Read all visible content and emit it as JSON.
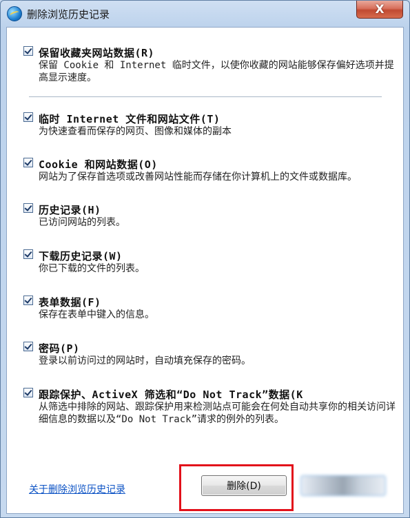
{
  "window": {
    "title": "删除浏览历史记录",
    "close_label": "X"
  },
  "options": [
    {
      "title": "保留收藏夹网站数据(R)",
      "desc": "保留 Cookie 和 Internet 临时文件，以使你收藏的网站能够保存偏好选项并提高显示速度。",
      "checked": true
    },
    {
      "title": "临时 Internet 文件和网站文件(T)",
      "desc": "为快速查看而保存的网页、图像和媒体的副本",
      "checked": true
    },
    {
      "title": "Cookie 和网站数据(O)",
      "desc": "网站为了保存首选项或改善网站性能而存储在你计算机上的文件或数据库。",
      "checked": true
    },
    {
      "title": "历史记录(H)",
      "desc": "已访问网站的列表。",
      "checked": true
    },
    {
      "title": "下载历史记录(W)",
      "desc": "你已下载的文件的列表。",
      "checked": true
    },
    {
      "title": "表单数据(F)",
      "desc": "保存在表单中键入的信息。",
      "checked": true
    },
    {
      "title": "密码(P)",
      "desc": "登录以前访问过的网站时，自动填充保存的密码。",
      "checked": true
    },
    {
      "title": "跟踪保护、ActiveX 筛选和“Do Not Track”数据(K",
      "desc": "从筛选中排除的网站、跟踪保护用来检测站点可能会在何处自动共享你的相关访问详细信息的数据以及“Do Not Track”请求的例外的列表。",
      "checked": true
    }
  ],
  "footer": {
    "about_link": "关于删除浏览历史记录",
    "delete_label": "删除(D)"
  },
  "colors": {
    "link": "#0a51c4",
    "highlight": "#e2101a",
    "close": "#c14a32"
  }
}
